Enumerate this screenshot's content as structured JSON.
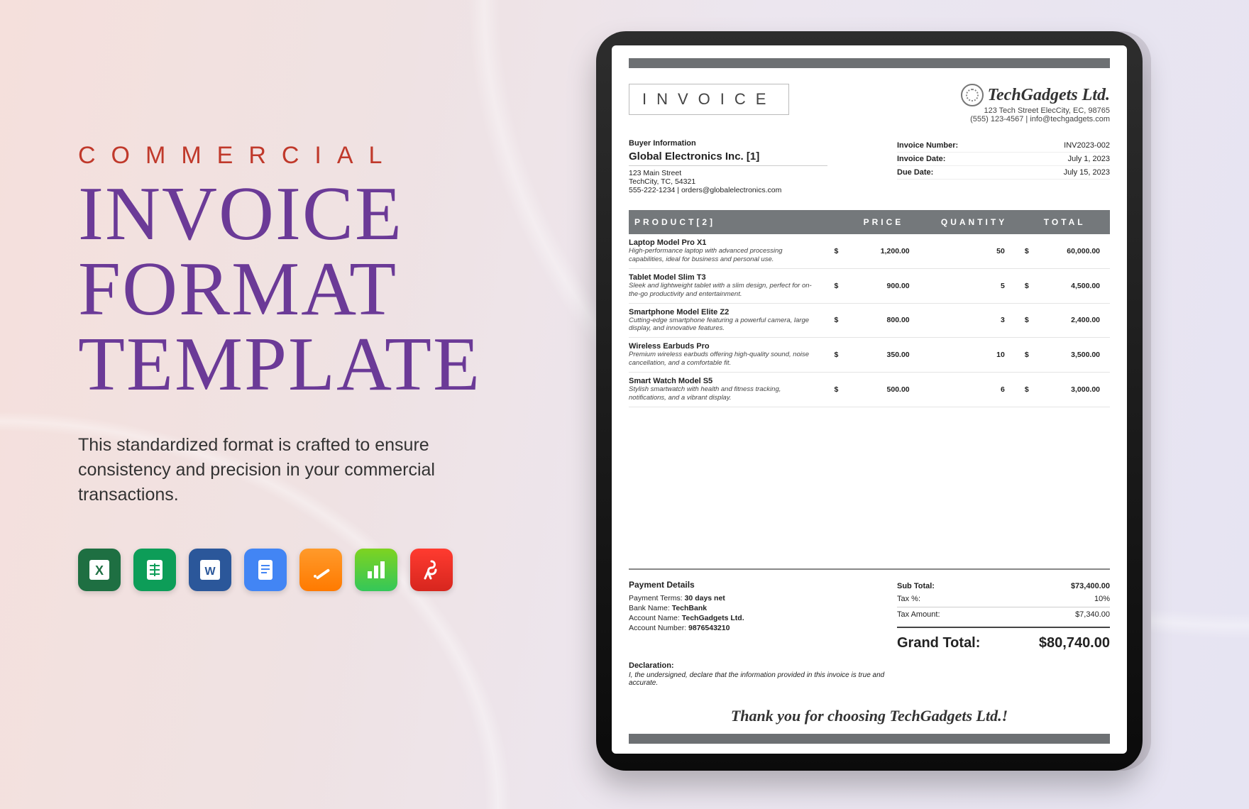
{
  "promo": {
    "eyebrow": "COMMERCIAL",
    "headline_l1": "INVOICE",
    "headline_l2": "FORMAT",
    "headline_l3": "TEMPLATE",
    "sub": "This standardized format is crafted to ensure consistency and precision in your commercial transactions."
  },
  "apps": [
    "excel",
    "google-sheets",
    "word",
    "google-docs",
    "pages",
    "numbers",
    "pdf"
  ],
  "invoice": {
    "label": "INVOICE",
    "company": {
      "name": "TechGadgets Ltd.",
      "addr": "123 Tech Street ElecCity, EC, 98765",
      "contact": "(555) 123-4567 | info@techgadgets.com"
    },
    "buyer": {
      "heading": "Buyer Information",
      "name": "Global Electronics Inc. [1]",
      "addr1": "123 Main Street",
      "addr2": "TechCity, TC, 54321",
      "contact": "555-222-1234 | orders@globalelectronics.com"
    },
    "meta": [
      {
        "label": "Invoice Number:",
        "value": "INV2023-002"
      },
      {
        "label": "Invoice Date:",
        "value": "July 1, 2023"
      },
      {
        "label": "Due Date:",
        "value": "July 15, 2023"
      }
    ],
    "columns": {
      "product": "PRODUCT[2]",
      "price": "PRICE",
      "qty": "QUANTITY",
      "total": "TOTAL"
    },
    "currency": "$",
    "items": [
      {
        "name": "Laptop Model Pro X1",
        "desc": "High-performance laptop with advanced processing capabilities, ideal for business and personal use.",
        "price": "1,200.00",
        "qty": "50",
        "total": "60,000.00"
      },
      {
        "name": "Tablet Model Slim T3",
        "desc": "Sleek and lightweight tablet with a slim design, perfect for on-the-go productivity and entertainment.",
        "price": "900.00",
        "qty": "5",
        "total": "4,500.00"
      },
      {
        "name": "Smartphone Model Elite Z2",
        "desc": "Cutting-edge smartphone featuring a powerful camera, large display, and innovative features.",
        "price": "800.00",
        "qty": "3",
        "total": "2,400.00"
      },
      {
        "name": "Wireless Earbuds Pro",
        "desc": "Premium wireless earbuds offering high-quality sound, noise cancellation, and a comfortable fit.",
        "price": "350.00",
        "qty": "10",
        "total": "3,500.00"
      },
      {
        "name": "Smart Watch Model S5",
        "desc": "Stylish smartwatch with health and fitness tracking, notifications, and a vibrant display.",
        "price": "500.00",
        "qty": "6",
        "total": "3,000.00"
      }
    ],
    "payment": {
      "heading": "Payment Details",
      "terms_label": "Payment Terms:",
      "terms": "30 days net",
      "bank_label": "Bank Name:",
      "bank": "TechBank",
      "acctname_label": "Account Name:",
      "acctname": "TechGadgets Ltd.",
      "acctno_label": "Account Number:",
      "acctno": "9876543210"
    },
    "totals": {
      "sub_label": "Sub Total:",
      "sub": "$73,400.00",
      "taxp_label": "Tax %:",
      "taxp": "10%",
      "taxa_label": "Tax Amount:",
      "taxa": "$7,340.00",
      "grand_label": "Grand Total:",
      "grand": "$80,740.00"
    },
    "declaration": {
      "heading": "Declaration:",
      "text": "I, the undersigned, declare that the information provided in this invoice is true and accurate."
    },
    "thanks": "Thank you for choosing TechGadgets Ltd.!"
  }
}
